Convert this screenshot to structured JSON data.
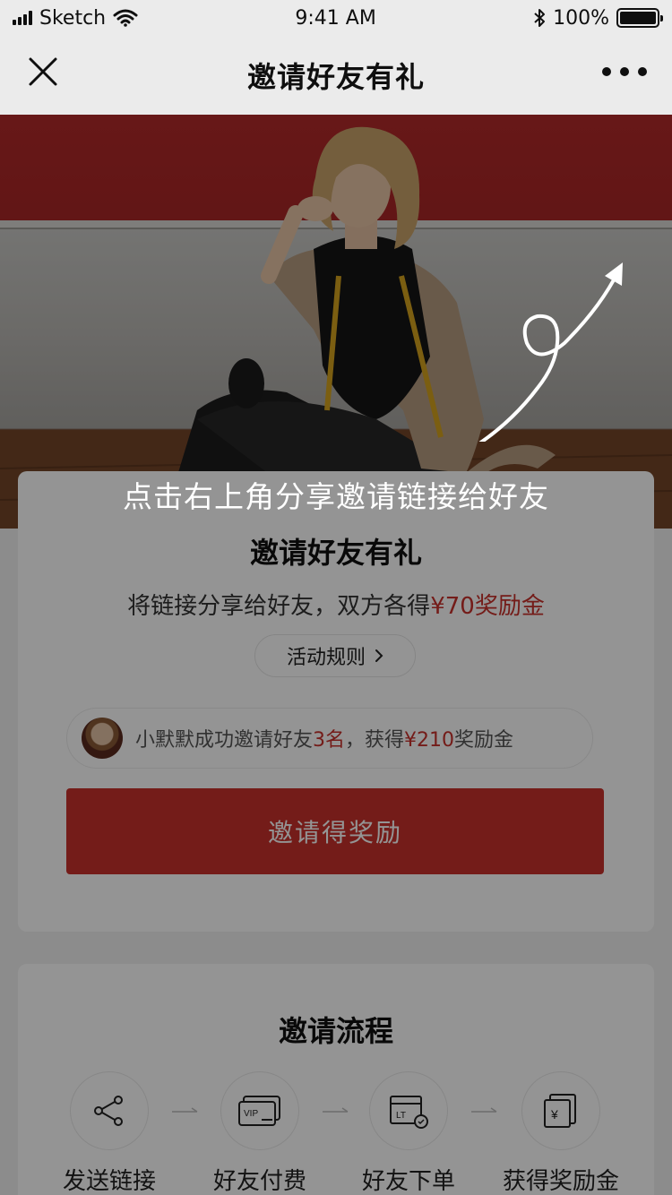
{
  "status_bar": {
    "carrier": "Sketch",
    "time": "9:41 AM",
    "battery": "100%"
  },
  "nav": {
    "title": "邀请好友有礼",
    "close_icon": "close-icon",
    "more_icon": "more-icon"
  },
  "hero": {
    "share_hint": "点击右上角分享邀请链接给好友"
  },
  "invite_card": {
    "title": "邀请好友有礼",
    "subtitle_prefix": "将链接分享给好友，双方各得",
    "subtitle_reward": "¥70奖励金",
    "rules_label": "活动规则",
    "record": {
      "name_text": "小默默成功邀请好友",
      "count": "3名",
      "mid_text": "，获得",
      "amount": "¥210",
      "suffix": "奖励金"
    },
    "button_label": "邀请得奖励"
  },
  "process_card": {
    "title": "邀请流程",
    "steps": [
      {
        "label": "发送链接",
        "icon": "share-icon"
      },
      {
        "label": "好友付费",
        "icon": "vip-card-icon"
      },
      {
        "label": "好友下单",
        "icon": "parcel-icon"
      },
      {
        "label": "获得奖励金",
        "icon": "reward-envelope-icon"
      }
    ]
  },
  "colors": {
    "accent": "#c8312b",
    "hero_red": "#b22a2a",
    "overlay": "rgba(0,0,0,0.42)"
  }
}
